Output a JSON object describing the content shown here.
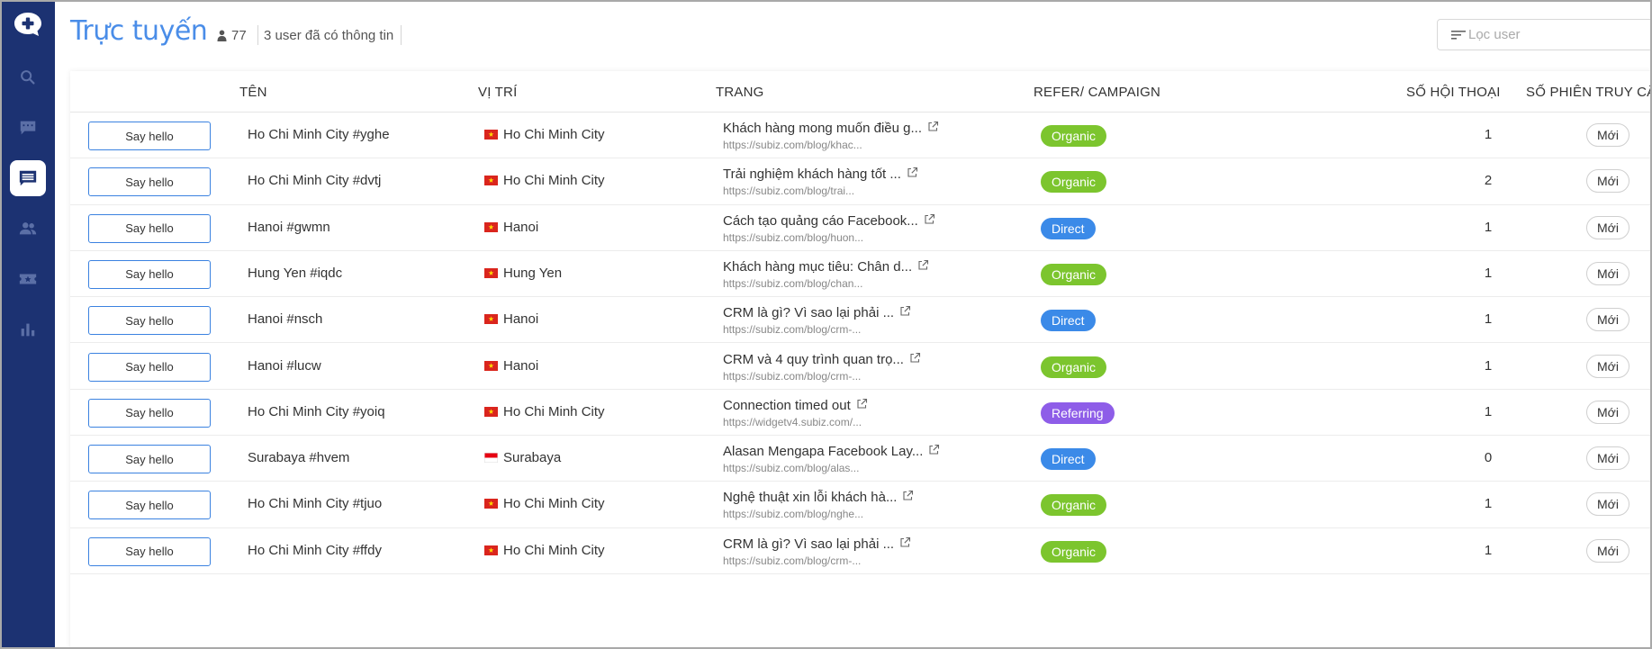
{
  "header": {
    "title": "Trực tuyến",
    "online_count": "77",
    "info_text": "3 user đã có thông tin",
    "filter_placeholder": "Lọc user"
  },
  "colors": {
    "sidebar": "#1c3272",
    "title": "#4a8de8",
    "organic": "#7cc52e",
    "direct": "#3b8ae8",
    "referring": "#8e5de8"
  },
  "sidebar": {
    "items": [
      {
        "icon": "search-icon",
        "active": false
      },
      {
        "icon": "chat-icon",
        "active": false
      },
      {
        "icon": "visitors-list-icon",
        "active": true
      },
      {
        "icon": "users-icon",
        "active": false
      },
      {
        "icon": "ticket-icon",
        "active": false
      },
      {
        "icon": "bar-chart-icon",
        "active": false
      }
    ]
  },
  "table": {
    "columns": [
      "TÊN",
      "VỊ TRÍ",
      "TRANG",
      "REFER/ CAMPAIGN",
      "SỐ HỘI THOẠI",
      "SỐ PHIÊN TRUY CẬP"
    ],
    "say_hello_label": "Say hello",
    "rows": [
      {
        "name": "Ho Chi Minh City #yghe",
        "location": "Ho Chi Minh City",
        "flag": "vn",
        "page_title": "Khách hàng mong muốn điều g...",
        "page_url": "https://subiz.com/blog/khac...",
        "campaign": "Organic",
        "conversations": "1",
        "sessions": "Mới"
      },
      {
        "name": "Ho Chi Minh City #dvtj",
        "location": "Ho Chi Minh City",
        "flag": "vn",
        "page_title": "Trải nghiệm khách hàng tốt ...",
        "page_url": "https://subiz.com/blog/trai...",
        "campaign": "Organic",
        "conversations": "2",
        "sessions": "Mới"
      },
      {
        "name": "Hanoi #gwmn",
        "location": "Hanoi",
        "flag": "vn",
        "page_title": "Cách tạo quảng cáo Facebook...",
        "page_url": "https://subiz.com/blog/huon...",
        "campaign": "Direct",
        "conversations": "1",
        "sessions": "Mới"
      },
      {
        "name": "Hung Yen #iqdc",
        "location": "Hung Yen",
        "flag": "vn",
        "page_title": "Khách hàng mục tiêu: Chân d...",
        "page_url": "https://subiz.com/blog/chan...",
        "campaign": "Organic",
        "conversations": "1",
        "sessions": "Mới"
      },
      {
        "name": "Hanoi #nsch",
        "location": "Hanoi",
        "flag": "vn",
        "page_title": "CRM là gì? Vì sao lại phải ...",
        "page_url": "https://subiz.com/blog/crm-...",
        "campaign": "Direct",
        "conversations": "1",
        "sessions": "Mới"
      },
      {
        "name": "Hanoi #lucw",
        "location": "Hanoi",
        "flag": "vn",
        "page_title": "CRM và 4 quy trình quan trọ...",
        "page_url": "https://subiz.com/blog/crm-...",
        "campaign": "Organic",
        "conversations": "1",
        "sessions": "Mới"
      },
      {
        "name": "Ho Chi Minh City #yoiq",
        "location": "Ho Chi Minh City",
        "flag": "vn",
        "page_title": "Connection timed out",
        "page_url": "https://widgetv4.subiz.com/...",
        "campaign": "Referring",
        "conversations": "1",
        "sessions": "Mới"
      },
      {
        "name": "Surabaya #hvem",
        "location": "Surabaya",
        "flag": "id",
        "page_title": "Alasan Mengapa Facebook Lay...",
        "page_url": "https://subiz.com/blog/alas...",
        "campaign": "Direct",
        "conversations": "0",
        "sessions": "Mới"
      },
      {
        "name": "Ho Chi Minh City #tjuo",
        "location": "Ho Chi Minh City",
        "flag": "vn",
        "page_title": "Nghệ thuật xin lỗi khách hà...",
        "page_url": "https://subiz.com/blog/nghe...",
        "campaign": "Organic",
        "conversations": "1",
        "sessions": "Mới"
      },
      {
        "name": "Ho Chi Minh City #ffdy",
        "location": "Ho Chi Minh City",
        "flag": "vn",
        "page_title": "CRM là gì? Vì sao lại phải ...",
        "page_url": "https://subiz.com/blog/crm-...",
        "campaign": "Organic",
        "conversations": "1",
        "sessions": "Mới"
      }
    ]
  }
}
